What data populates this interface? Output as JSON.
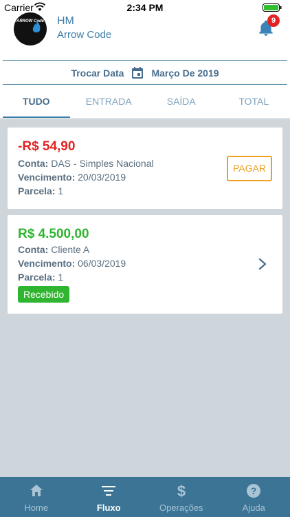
{
  "status_bar": {
    "carrier": "Carrier",
    "time": "2:34 PM"
  },
  "header": {
    "avatar_text": "ARROW Code",
    "user_initials": "HM",
    "company": "Arrow Code",
    "notification_count": "9"
  },
  "date_filter": {
    "label": "Trocar Data",
    "value": "Março De 2019"
  },
  "tabs": [
    {
      "label": "TUDO",
      "active": true
    },
    {
      "label": "ENTRADA",
      "active": false
    },
    {
      "label": "SAÍDA",
      "active": false
    },
    {
      "label": "TOTAL",
      "active": false
    }
  ],
  "entries": [
    {
      "amount": "-R$ 54,90",
      "type": "negative",
      "conta_label": "Conta:",
      "conta": "DAS - Simples Nacional",
      "vencimento_label": "Vencimento:",
      "vencimento": "20/03/2019",
      "parcela_label": "Parcela:",
      "parcela": "1",
      "action": "PAGAR"
    },
    {
      "amount": "R$ 4.500,00",
      "type": "positive",
      "conta_label": "Conta:",
      "conta": "Cliente A",
      "vencimento_label": "Vencimento:",
      "vencimento": "06/03/2019",
      "parcela_label": "Parcela:",
      "parcela": "1",
      "status": "Recebido"
    }
  ],
  "bottom_nav": [
    {
      "label": "Home",
      "icon": "home-icon",
      "active": false
    },
    {
      "label": "Fluxo",
      "icon": "list-icon",
      "active": true
    },
    {
      "label": "Operações",
      "icon": "dollar-icon",
      "active": false
    },
    {
      "label": "Ajuda",
      "icon": "help-icon",
      "active": false
    }
  ],
  "colors": {
    "primary": "#3b7494",
    "negative": "#e52222",
    "positive": "#2fb52f",
    "warning": "#f0a020"
  }
}
